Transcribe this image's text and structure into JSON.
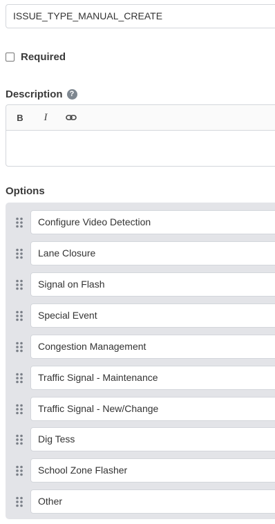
{
  "key_field": {
    "value": "ISSUE_TYPE_MANUAL_CREATE"
  },
  "required": {
    "label": "Required",
    "checked": false
  },
  "description": {
    "label": "Description",
    "help_icon": "?",
    "toolbar": {
      "bold": "B",
      "italic": "I"
    },
    "value": ""
  },
  "options": {
    "label": "Options",
    "items": [
      "Configure Video Detection",
      "Lane Closure",
      "Signal on Flash",
      "Special Event",
      "Congestion Management",
      "Traffic Signal - Maintenance",
      "Traffic Signal - New/Change",
      "Dig Tess",
      "School Zone Flasher",
      "Other"
    ]
  },
  "colors": {
    "panel_bg": "#e3e4e8",
    "border": "#d3d6db",
    "help_icon_bg": "#7e8790"
  }
}
